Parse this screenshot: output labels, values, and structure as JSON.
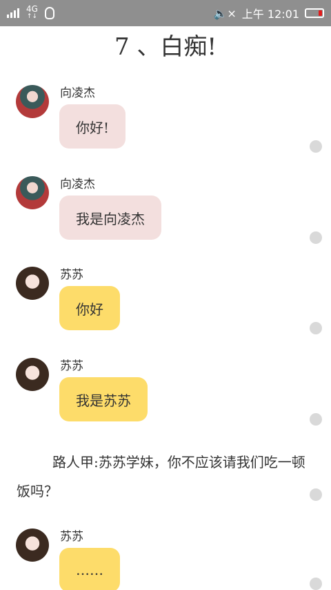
{
  "status": {
    "network": "4G",
    "time": "上午 12:01",
    "mute_glyph": "×"
  },
  "title": "7 、白痴!",
  "messages": [
    {
      "name": "向凌杰",
      "text": "你好!"
    },
    {
      "name": "向凌杰",
      "text": "我是向凌杰"
    },
    {
      "name": "苏苏",
      "text": "你好"
    },
    {
      "name": "苏苏",
      "text": "我是苏苏"
    },
    {
      "name": "苏苏",
      "text": "……"
    }
  ],
  "narration": "路人甲:苏苏学妹，你不应该请我们吃一顿饭吗？",
  "colors": {
    "status_bar": "#8f8f8f",
    "bubble_pink": "#f3dfde",
    "bubble_yellow": "#fddc6a",
    "dot": "#d9d9d9"
  }
}
